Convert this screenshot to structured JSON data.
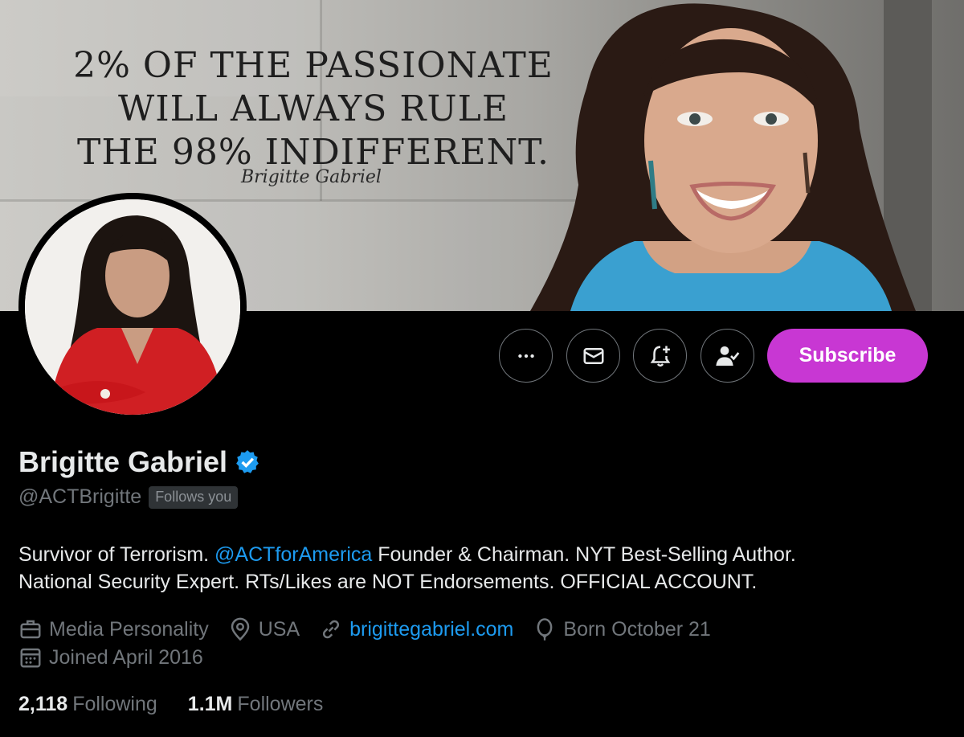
{
  "banner": {
    "quote_lines": [
      "2% OF THE PASSIONATE",
      "WILL ALWAYS RULE",
      "THE 98% INDIFFERENT."
    ],
    "signature": "Brigitte Gabriel"
  },
  "actions": {
    "more_icon": "more-horizontal-icon",
    "message_icon": "envelope-icon",
    "notify_icon": "bell-plus-icon",
    "following_icon": "person-check-icon",
    "subscribe_label": "Subscribe"
  },
  "profile": {
    "name": "Brigitte Gabriel",
    "handle": "@ACTBrigitte",
    "follows_you": "Follows you",
    "bio_prefix": "Survivor of Terrorism. ",
    "bio_mention": "@ACTforAmerica",
    "bio_line1_suffix": " Founder & Chairman. NYT Best-Selling Author.",
    "bio_line2": "National Security Expert. RTs/Likes are NOT Endorsements. OFFICIAL ACCOUNT.",
    "category": "Media Personality",
    "location": "USA",
    "website": "brigittegabriel.com",
    "birthday": "Born October 21",
    "joined": "Joined April 2016"
  },
  "stats": {
    "following_count": "2,118",
    "following_label": "Following",
    "followers_count": "1.1M",
    "followers_label": "Followers"
  },
  "colors": {
    "accent": "#1d9bf0",
    "subscribe": "#c837d3",
    "muted": "#71767b"
  }
}
